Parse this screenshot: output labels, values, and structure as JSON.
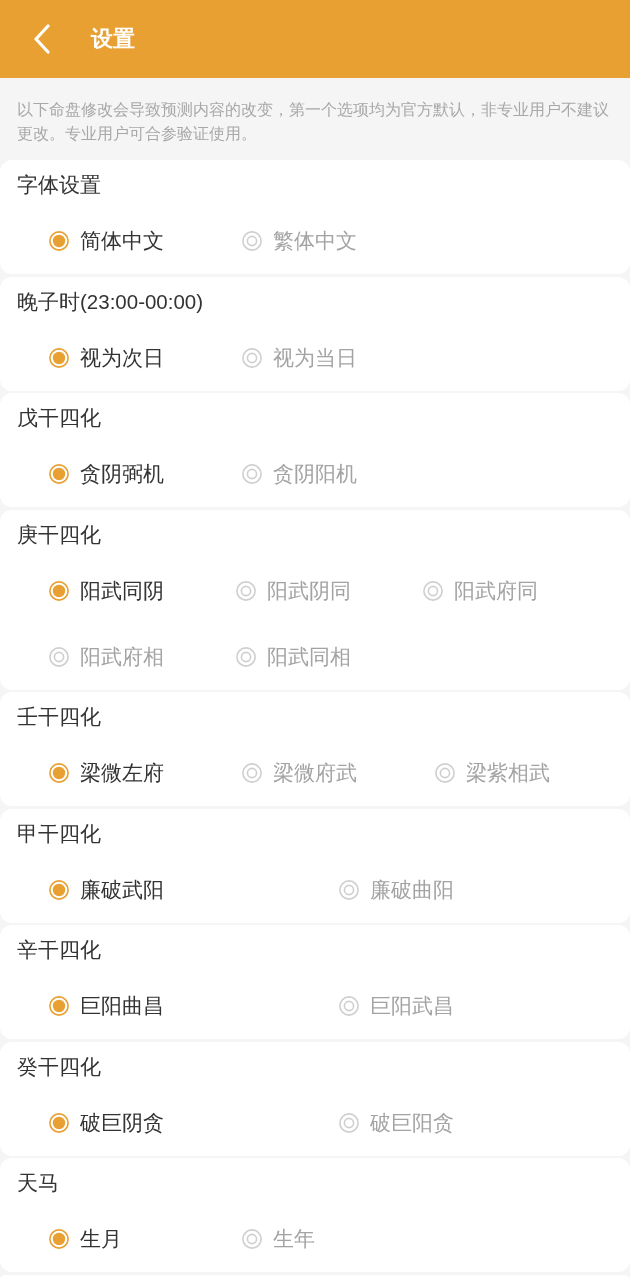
{
  "header": {
    "title": "设置"
  },
  "notice": "以下命盘修改会导致预测内容的改变，第一个选项均为官方默认，非专业用户不建议更改。专业用户可合参验证使用。",
  "sections": [
    {
      "title": "字体设置",
      "kind": "narrow",
      "options": [
        {
          "label": "简体中文",
          "selected": true
        },
        {
          "label": "繁体中文",
          "selected": false
        }
      ]
    },
    {
      "title": "晚子时(23:00-00:00)",
      "kind": "narrow",
      "options": [
        {
          "label": "视为次日",
          "selected": true
        },
        {
          "label": "视为当日",
          "selected": false
        }
      ]
    },
    {
      "title": "戊干四化",
      "kind": "narrow",
      "options": [
        {
          "label": "贪阴弼机",
          "selected": true
        },
        {
          "label": "贪阴阳机",
          "selected": false
        }
      ]
    },
    {
      "title": "庚干四化",
      "kind": "wrap",
      "options": [
        {
          "label": "阳武同阴",
          "selected": true
        },
        {
          "label": "阳武阴同",
          "selected": false
        },
        {
          "label": "阳武府同",
          "selected": false
        },
        {
          "label": "阳武府相",
          "selected": false
        },
        {
          "label": "阳武同相",
          "selected": false
        }
      ]
    },
    {
      "title": "壬干四化",
      "kind": "narrow",
      "options": [
        {
          "label": "梁微左府",
          "selected": true
        },
        {
          "label": "梁微府武",
          "selected": false
        },
        {
          "label": "梁紫相武",
          "selected": false
        }
      ]
    },
    {
      "title": "甲干四化",
      "kind": "wide",
      "options": [
        {
          "label": "廉破武阳",
          "selected": true
        },
        {
          "label": "廉破曲阳",
          "selected": false
        }
      ]
    },
    {
      "title": "辛干四化",
      "kind": "wide",
      "options": [
        {
          "label": "巨阳曲昌",
          "selected": true
        },
        {
          "label": "巨阳武昌",
          "selected": false
        }
      ]
    },
    {
      "title": "癸干四化",
      "kind": "wide",
      "options": [
        {
          "label": "破巨阴贪",
          "selected": true
        },
        {
          "label": "破巨阳贪",
          "selected": false
        }
      ]
    },
    {
      "title": "天马",
      "kind": "narrow",
      "options": [
        {
          "label": "生月",
          "selected": true
        },
        {
          "label": "生年",
          "selected": false
        }
      ]
    }
  ]
}
